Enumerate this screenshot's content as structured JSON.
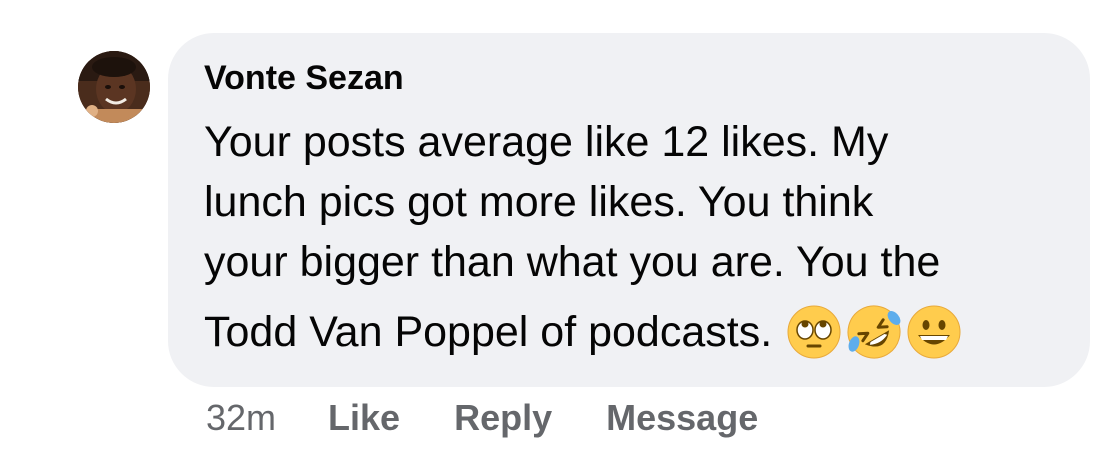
{
  "comment": {
    "author": "Vonte Sezan",
    "avatar_alt": "profile photo",
    "lines": [
      "Your posts average like 12 likes. My",
      "lunch pics got more likes. You think",
      "your bigger than what you are. You the",
      "Todd Van Poppel of podcasts."
    ],
    "emojis": [
      "face-with-rolling-eyes-emoji",
      "rolling-on-floor-laughing-emoji",
      "grinning-face-emoji"
    ],
    "timestamp": "32m",
    "actions": {
      "like": "Like",
      "reply": "Reply",
      "message": "Message"
    }
  },
  "colors": {
    "bubble_bg": "#f0f1f4",
    "text_primary": "#050505",
    "text_secondary": "#65676b",
    "emoji_yellow": "#ffcc4d"
  }
}
